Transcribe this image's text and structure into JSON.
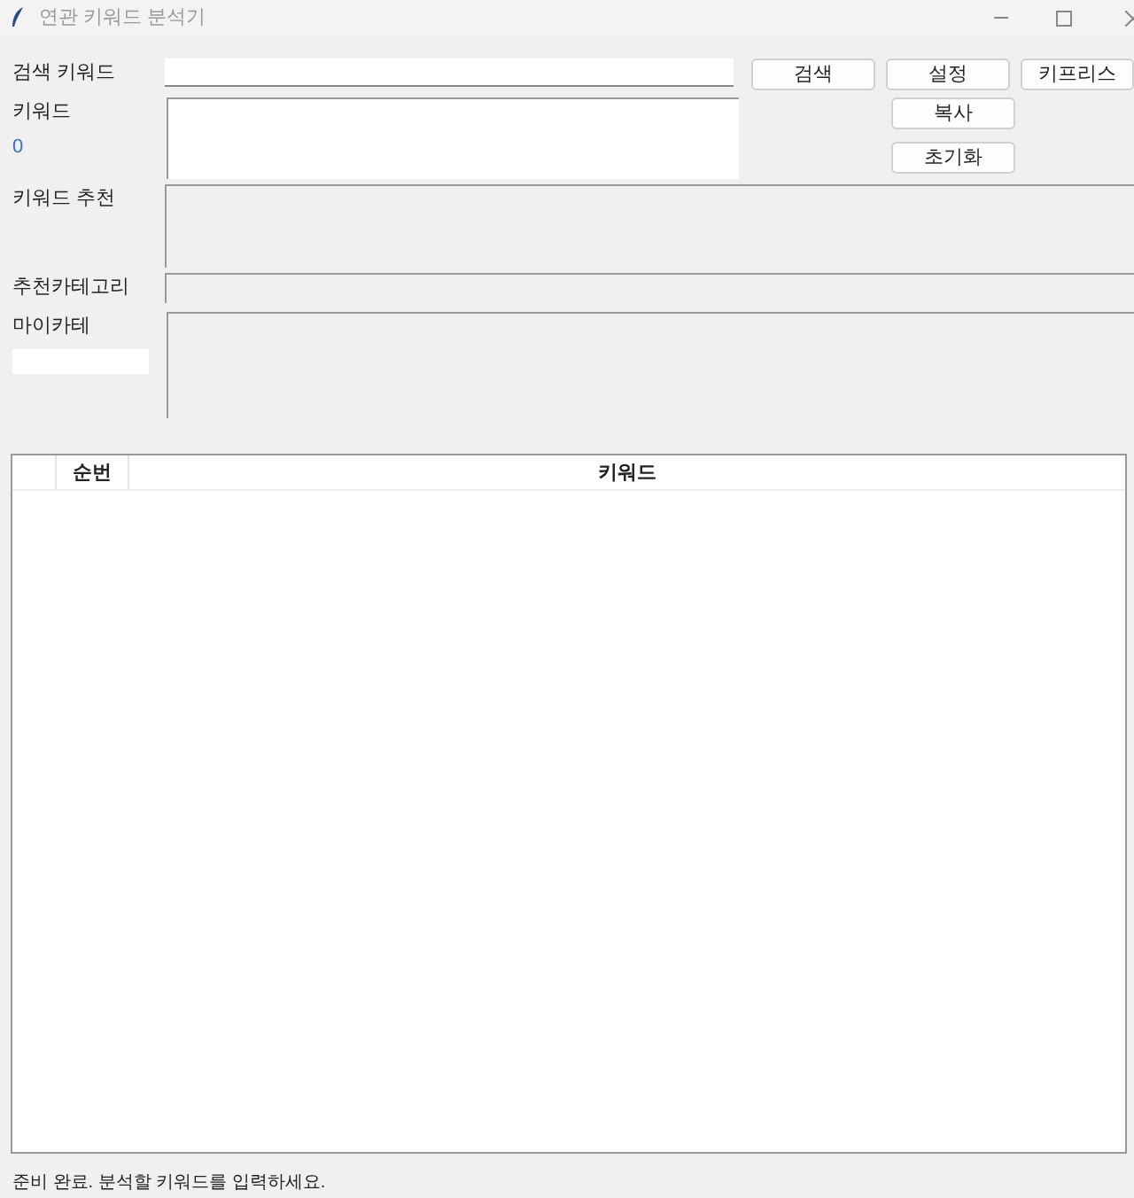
{
  "window": {
    "title": "연관 키워드 분석기"
  },
  "search": {
    "label": "검색 키워드"
  },
  "buttons": [
    {
      "label": "검색"
    },
    {
      "label": "설정"
    },
    {
      "label": "키프리스"
    },
    {
      "label": "복사"
    },
    {
      "label": "초기화"
    }
  ],
  "keywords": {
    "label": "키워드",
    "count": "0"
  },
  "recommend": {
    "label": "키워드 추천"
  },
  "category": {
    "label": "추천카테고리"
  },
  "my_category": {
    "label": "마이카테"
  },
  "table": {
    "columns": [
      "",
      "순번",
      "키워드"
    ]
  },
  "status_bar": "준비 완료. 분석할 키워드를 입력하세요."
}
